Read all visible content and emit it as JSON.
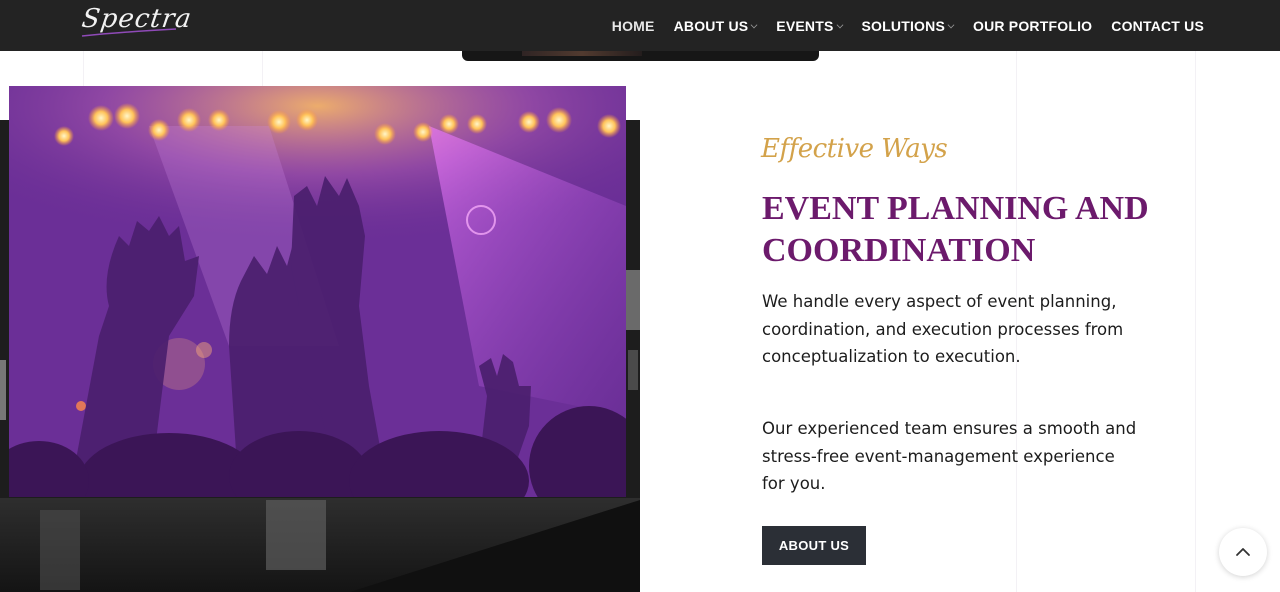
{
  "header": {
    "logo_text": "Spectra",
    "nav": [
      {
        "label": "HOME",
        "has_dropdown": false
      },
      {
        "label": "ABOUT US",
        "has_dropdown": true
      },
      {
        "label": "EVENTS",
        "has_dropdown": true
      },
      {
        "label": "SOLUTIONS",
        "has_dropdown": true
      },
      {
        "label": "OUR PORTFOLIO",
        "has_dropdown": false
      },
      {
        "label": "CONTACT US",
        "has_dropdown": false
      }
    ]
  },
  "section": {
    "subtitle": "Effective Ways",
    "heading_line1": "EVENT PLANNING AND",
    "heading_line2": "COORDINATION",
    "paragraph1": "We handle every aspect of event planning, coordination, and execution processes from conceptualization to execution.",
    "paragraph2": "Our experienced team ensures a smooth and stress-free event-management experience for you.",
    "button_label": "ABOUT US"
  },
  "images": {
    "front": "concert-crowd-hands-purple-lights",
    "back": "grayscale-venue-photo"
  },
  "icons": {
    "scroll_top": "chevron-up-icon",
    "dropdown": "chevron-down-icon"
  },
  "colors": {
    "header_bg": "#232323",
    "heading": "#6c1a6c",
    "subtitle": "#d3a24a",
    "button_bg": "#2b2f36"
  }
}
